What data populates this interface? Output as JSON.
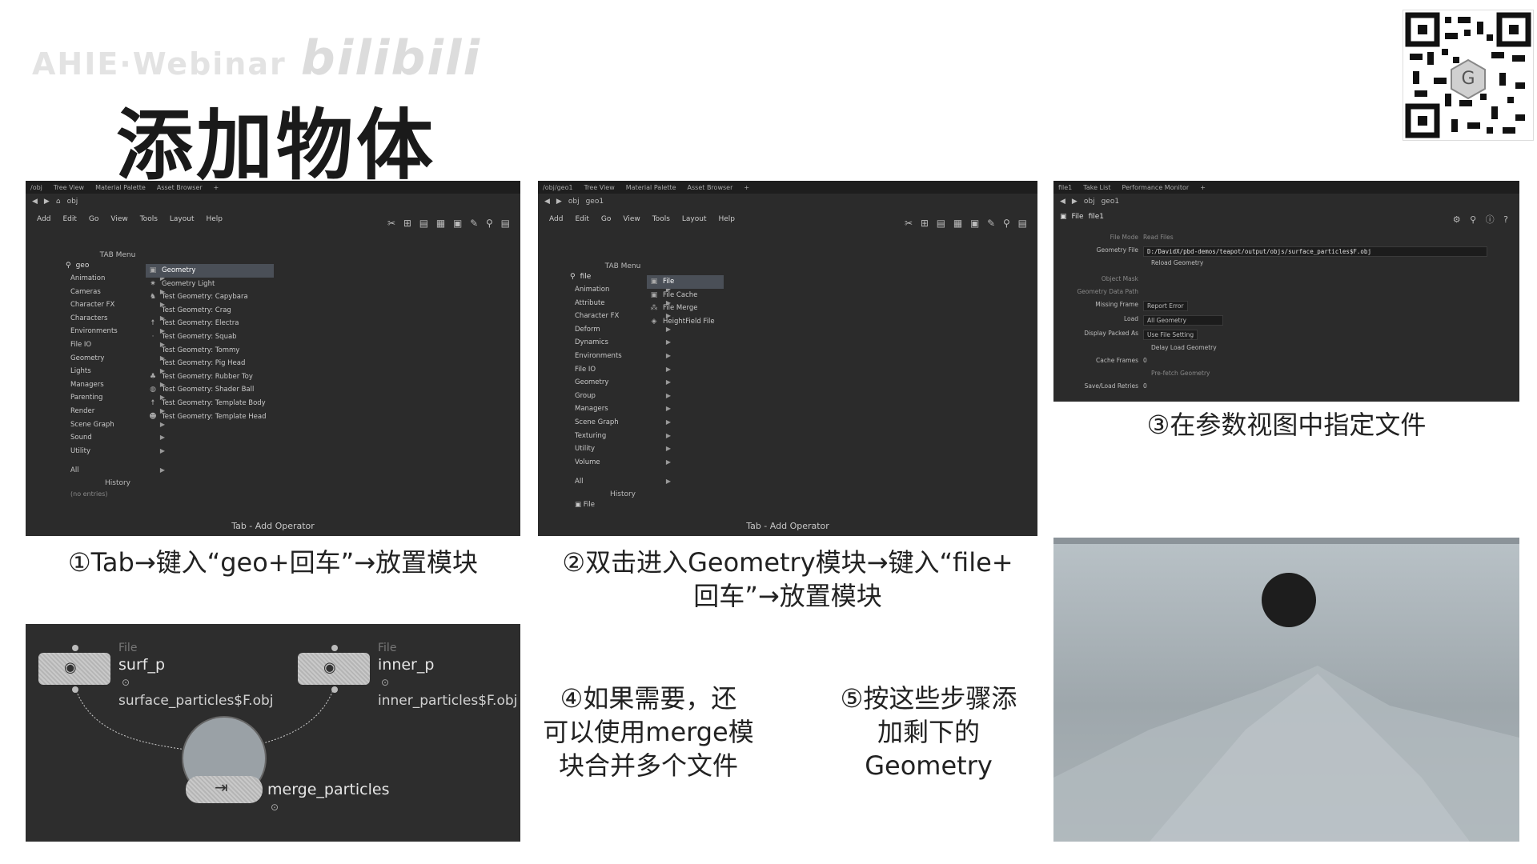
{
  "header": {
    "watermark": "AHIE·Webinar",
    "watermark_logo": "bilibili",
    "title": "添加物体"
  },
  "qr": {
    "icon": "qr-code-icon"
  },
  "panel1": {
    "tabs": [
      "/obj",
      "Tree View",
      "Material Palette",
      "Asset Browser"
    ],
    "path": "obj",
    "menu": [
      "Add",
      "Edit",
      "Go",
      "View",
      "Tools",
      "Layout",
      "Help"
    ],
    "tab_menu_title": "TAB Menu",
    "search": "geo",
    "categories": [
      "Animation",
      "Cameras",
      "Character FX",
      "Characters",
      "Environments",
      "File IO",
      "Geometry",
      "Lights",
      "Managers",
      "Parenting",
      "Render",
      "Scene Graph",
      "Sound",
      "Utility"
    ],
    "all": "All",
    "history": "History",
    "no_entries": "(no entries)",
    "results": [
      "Geometry",
      "Geometry Light",
      "Test Geometry: Capybara",
      "Test Geometry: Crag",
      "Test Geometry: Electra",
      "Test Geometry: Squab",
      "Test Geometry: Tommy",
      "Test Geometry: Pig Head",
      "Test Geometry: Rubber Toy",
      "Test Geometry: Shader Ball",
      "Test Geometry: Template Body",
      "Test Geometry: Template Head"
    ],
    "footer": "Tab - Add Operator"
  },
  "panel2": {
    "tabs": [
      "/obj/geo1",
      "Tree View",
      "Material Palette",
      "Asset Browser"
    ],
    "path": [
      "obj",
      "geo1"
    ],
    "menu": [
      "Add",
      "Edit",
      "Go",
      "View",
      "Tools",
      "Layout",
      "Help"
    ],
    "tab_menu_title": "TAB Menu",
    "search": "file",
    "categories": [
      "Animation",
      "Attribute",
      "Character FX",
      "Deform",
      "Dynamics",
      "Environments",
      "File IO",
      "Geometry",
      "Group",
      "Managers",
      "Scene Graph",
      "Texturing",
      "Utility",
      "Volume"
    ],
    "all": "All",
    "history": "History",
    "history_item": "File",
    "results": [
      "File",
      "File Cache",
      "File Merge",
      "HeightField File"
    ],
    "footer": "Tab - Add Operator"
  },
  "panel3": {
    "tabs": [
      "file1",
      "Take List",
      "Performance Monitor"
    ],
    "path": [
      "obj",
      "geo1"
    ],
    "node_type": "File",
    "node_name": "file1",
    "params": {
      "file_mode_label": "File Mode",
      "file_mode": "Read Files",
      "geometry_file_label": "Geometry File",
      "geometry_file": "D:/DavidX/pbd-demos/teapot/output/objs/surface_particles$F.obj",
      "reload": "Reload Geometry",
      "object_mask_label": "Object Mask",
      "data_path_label": "Geometry Data Path",
      "missing_frame_label": "Missing Frame",
      "missing_frame": "Report Error",
      "load_label": "Load",
      "load": "All Geometry",
      "display_packed_label": "Display Packed As",
      "display_packed": "Use File Setting",
      "delay_load": "Delay Load Geometry",
      "cache_frames_label": "Cache Frames",
      "cache_frames": "0",
      "prefetch": "Pre-fetch Geometry",
      "retries_label": "Save/Load Retries",
      "retries": "0"
    }
  },
  "panel4": {
    "nodes": [
      {
        "type": "File",
        "name": "surf_p",
        "file": "surface_particles$F.obj"
      },
      {
        "type": "File",
        "name": "inner_p",
        "file": "inner_particles$F.obj"
      },
      {
        "type": "",
        "name": "merge_particles",
        "file": ""
      }
    ]
  },
  "captions": {
    "c1": "①Tab→键入“geo+回车”→放置模块",
    "c2_line1": "②双击进入Geometry模块→键入“file+",
    "c2_line2": "回车”→放置模块",
    "c3": "③在参数视图中指定文件",
    "c4_line1": "④如果需要，还",
    "c4_line2": "可以使用merge模",
    "c4_line3": "块合并多个文件",
    "c5_line1": "⑤按这些步骤添",
    "c5_line2": "加剩下的",
    "c5_line3": "Geometry"
  },
  "colors": {
    "panel_bg": "#2b2b2b",
    "highlight": "#4a4f57",
    "viewport_sky": "#a9b3b9"
  }
}
